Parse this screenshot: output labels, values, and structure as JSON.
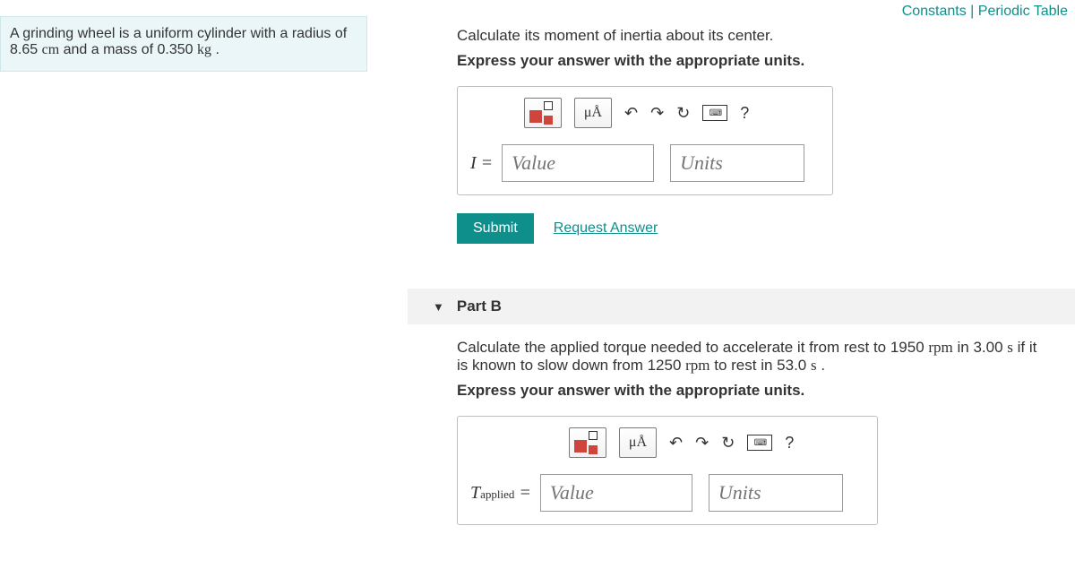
{
  "top_links": {
    "constants": "Constants",
    "sep": " | ",
    "periodic": "Periodic Table"
  },
  "problem": {
    "text_a": "A grinding wheel is a uniform cylinder with a radius of 8.65 ",
    "cm": "cm",
    "text_b": " and a mass of 0.350 ",
    "kg": "kg",
    "text_c": " ."
  },
  "partA": {
    "prompt": "Calculate its moment of inertia about its center.",
    "instr": "Express your answer with the appropriate units.",
    "mu": "μÅ",
    "lhs": "I =",
    "value_ph": "Value",
    "units_ph": "Units",
    "submit": "Submit",
    "request": "Request Answer",
    "help": "?"
  },
  "partB": {
    "header": "Part B",
    "p1a": "Calculate the applied torque needed to accelerate it from rest to 1950 ",
    "rpm1": "rpm",
    "p1b": " in 3.00 ",
    "s1": "s",
    "p1c": " if it is known to slow down from 1250 ",
    "rpm2": "rpm",
    "p1d": " to rest in 53.0 ",
    "s2": "s",
    "p1e": " .",
    "instr": "Express your answer with the appropriate units.",
    "mu": "μÅ",
    "lhs_a": "T",
    "lhs_b": "applied",
    "lhs_c": " =",
    "value_ph": "Value",
    "units_ph": "Units",
    "help": "?"
  }
}
